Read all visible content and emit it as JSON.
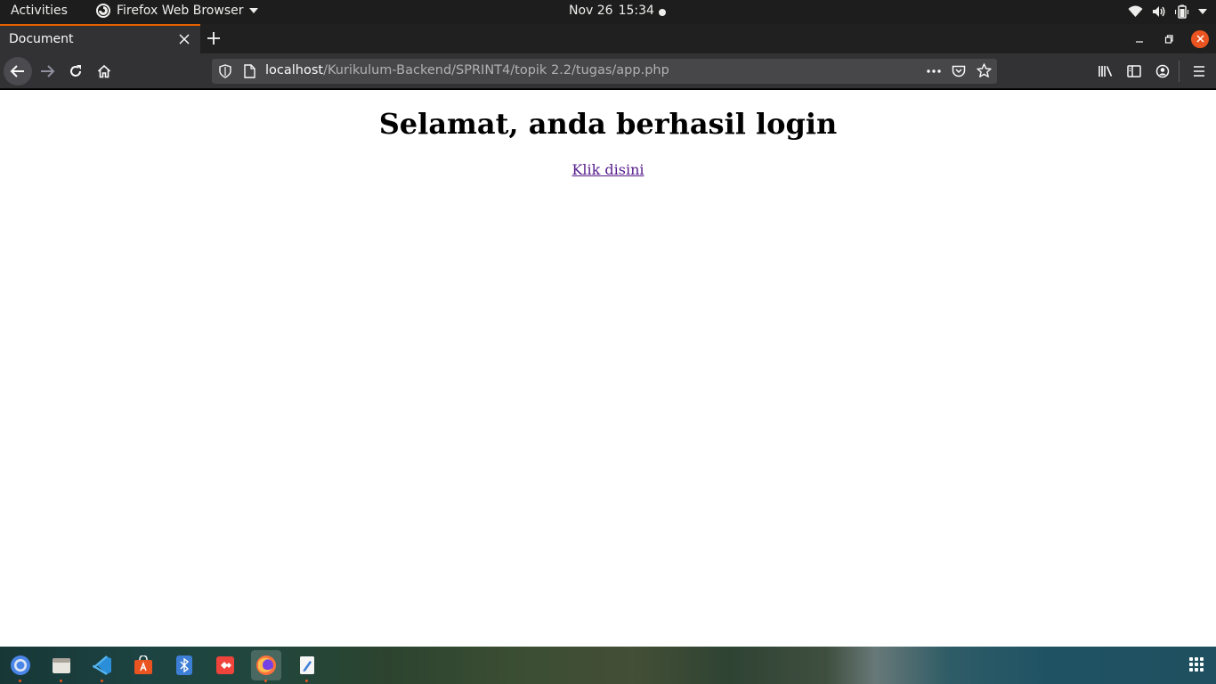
{
  "topbar": {
    "activities": "Activities",
    "app_name": "Firefox Web Browser",
    "clock_date": "Nov 26",
    "clock_time": "15:34"
  },
  "tabs": [
    {
      "title": "Document",
      "active": true
    }
  ],
  "urlbar": {
    "host": "localhost",
    "path": "/Kurikulum-Backend/SPRINT4/topik 2.2/tugas/app.php"
  },
  "page": {
    "heading": "Selamat, anda berhasil login",
    "link_text": "Klik disini"
  },
  "dock": {
    "apps": [
      "chrome-icon",
      "files-icon",
      "vscode-icon",
      "software-icon",
      "bluetooth-icon",
      "anydesk-icon",
      "firefox-icon",
      "text-editor-icon"
    ],
    "active_app": "firefox-icon"
  },
  "colors": {
    "accent": "#e66000",
    "ubuntu_orange": "#e95420",
    "link_visited": "#551a8b",
    "toolbar": "#323234"
  }
}
